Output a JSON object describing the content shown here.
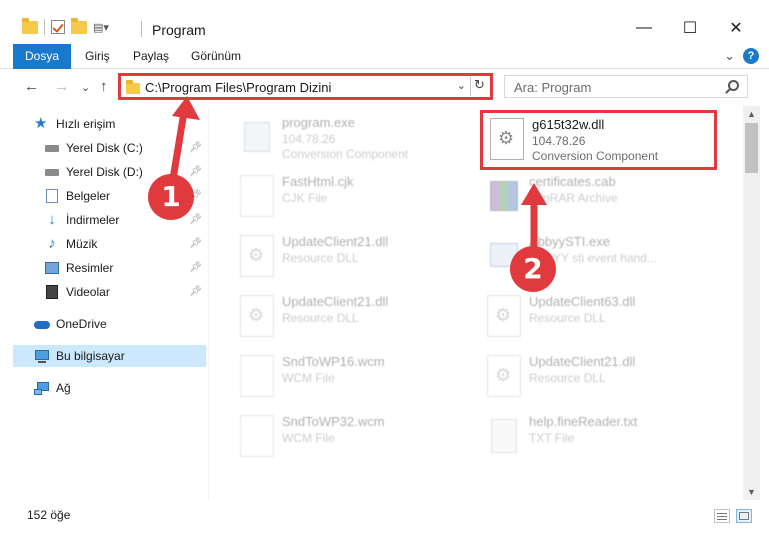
{
  "window": {
    "title": "Program",
    "minimize": "—",
    "maximize": "☐",
    "close": "✕"
  },
  "ribbon": {
    "tabs": [
      "Dosya",
      "Giriş",
      "Paylaş",
      "Görünüm"
    ],
    "expand": "⌄",
    "help": "?"
  },
  "nav": {
    "back": "←",
    "forward": "→",
    "recent": "⌄",
    "up": "↑",
    "address": "C:\\Program Files\\Program Dizini",
    "address_dropdown": "⌄",
    "refresh": "↻",
    "search_placeholder": "Ara: Program"
  },
  "sidebar": {
    "items": [
      {
        "label": "Hızlı erişim",
        "icon": "star-icon"
      },
      {
        "label": "Yerel Disk (C:)",
        "icon": "drive-icon",
        "pinned": true
      },
      {
        "label": "Yerel Disk (D:)",
        "icon": "drive-icon",
        "pinned": true
      },
      {
        "label": "Belgeler",
        "icon": "documents-icon",
        "pinned": true
      },
      {
        "label": "İndirmeler",
        "icon": "download-icon",
        "pinned": true
      },
      {
        "label": "Müzik",
        "icon": "music-icon",
        "pinned": true
      },
      {
        "label": "Resimler",
        "icon": "pictures-icon",
        "pinned": true
      },
      {
        "label": "Videolar",
        "icon": "videos-icon",
        "pinned": true
      },
      {
        "label": "OneDrive",
        "icon": "cloud-icon"
      },
      {
        "label": "Bu bilgisayar",
        "icon": "computer-icon",
        "selected": true
      },
      {
        "label": "Ağ",
        "icon": "network-icon"
      }
    ]
  },
  "files": [
    {
      "name": "program.exe",
      "line1": "104.78.26",
      "line2": "Conversion Component",
      "faded": true
    },
    {
      "name": "g615t32w.dll",
      "line1": "104.78.26",
      "line2": "Conversion Component",
      "faded": false
    },
    {
      "name": "FastHtml.cjk",
      "line1": "CJK File",
      "faded": true
    },
    {
      "name": "certificates.cab",
      "line1": "WinRAR Archive",
      "faded": true
    },
    {
      "name": "UpdateClient21.dll",
      "line1": "Resource DLL",
      "faded": true
    },
    {
      "name": "AbbyySTI.exe",
      "line1": "ABBYY sti event hand...",
      "faded": true
    },
    {
      "name": "UpdateClient21.dll",
      "line1": "Resource DLL",
      "faded": true
    },
    {
      "name": "UpdateClient63.dll",
      "line1": "Resource DLL",
      "faded": true
    },
    {
      "name": "SndToWP16.wcm",
      "line1": "WCM File",
      "faded": true
    },
    {
      "name": "UpdateClient21.dll",
      "line1": "Resource DLL",
      "faded": true
    },
    {
      "name": "SndToWP32.wcm",
      "line1": "WCM File",
      "faded": true
    },
    {
      "name": "help.fineReader.txt",
      "line1": "TXT File",
      "faded": true
    }
  ],
  "status": {
    "count": "152 öğe"
  },
  "markers": [
    "1",
    "2"
  ],
  "colors": {
    "accent": "#1979ca",
    "highlight": "#e03a3e",
    "selection": "#cce8ff"
  }
}
